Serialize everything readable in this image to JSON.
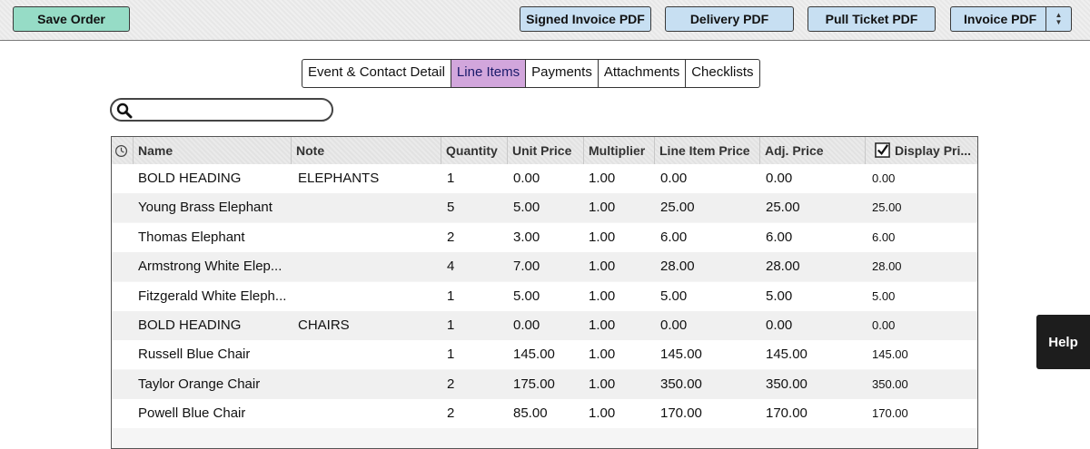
{
  "toolbar": {
    "save_order": "Save Order",
    "signed_invoice_pdf": "Signed Invoice PDF",
    "delivery_pdf": "Delivery PDF",
    "pull_ticket_pdf": "Pull Ticket PDF",
    "invoice_pdf": "Invoice PDF"
  },
  "tabs": [
    {
      "label": "Event & Contact Detail",
      "active": false
    },
    {
      "label": "Line Items",
      "active": true
    },
    {
      "label": "Payments",
      "active": false
    },
    {
      "label": "Attachments",
      "active": false
    },
    {
      "label": "Checklists",
      "active": false
    }
  ],
  "search": {
    "value": "",
    "placeholder": ""
  },
  "columns": {
    "name": "Name",
    "note": "Note",
    "quantity": "Quantity",
    "unit_price": "Unit Price",
    "multiplier": "Multiplier",
    "line_item_price": "Line Item Price",
    "adj_price": "Adj. Price",
    "display_price": "Display Pri..."
  },
  "rows": [
    {
      "name": "BOLD HEADING",
      "note": "ELEPHANTS",
      "quantity": "1",
      "unit_price": "0.00",
      "multiplier": "1.00",
      "line_item_price": "0.00",
      "adj_price": "0.00",
      "display_price": "0.00"
    },
    {
      "name": "Young Brass Elephant",
      "note": "",
      "quantity": "5",
      "unit_price": "5.00",
      "multiplier": "1.00",
      "line_item_price": "25.00",
      "adj_price": "25.00",
      "display_price": "25.00"
    },
    {
      "name": "Thomas Elephant",
      "note": "",
      "quantity": "2",
      "unit_price": "3.00",
      "multiplier": "1.00",
      "line_item_price": "6.00",
      "adj_price": "6.00",
      "display_price": "6.00"
    },
    {
      "name": "Armstrong White Elep...",
      "note": "",
      "quantity": "4",
      "unit_price": "7.00",
      "multiplier": "1.00",
      "line_item_price": "28.00",
      "adj_price": "28.00",
      "display_price": "28.00"
    },
    {
      "name": "Fitzgerald White Eleph...",
      "note": "",
      "quantity": "1",
      "unit_price": "5.00",
      "multiplier": "1.00",
      "line_item_price": "5.00",
      "adj_price": "5.00",
      "display_price": "5.00"
    },
    {
      "name": "BOLD HEADING",
      "note": "CHAIRS",
      "quantity": "1",
      "unit_price": "0.00",
      "multiplier": "1.00",
      "line_item_price": "0.00",
      "adj_price": "0.00",
      "display_price": "0.00"
    },
    {
      "name": "Russell Blue Chair",
      "note": "",
      "quantity": "1",
      "unit_price": "145.00",
      "multiplier": "1.00",
      "line_item_price": "145.00",
      "adj_price": "145.00",
      "display_price": "145.00"
    },
    {
      "name": "Taylor Orange Chair",
      "note": "",
      "quantity": "2",
      "unit_price": "175.00",
      "multiplier": "1.00",
      "line_item_price": "350.00",
      "adj_price": "350.00",
      "display_price": "350.00"
    },
    {
      "name": "Powell Blue Chair",
      "note": "",
      "quantity": "2",
      "unit_price": "85.00",
      "multiplier": "1.00",
      "line_item_price": "170.00",
      "adj_price": "170.00",
      "display_price": "170.00"
    }
  ],
  "help": {
    "label": "Help"
  },
  "icons": {
    "search": "search-icon",
    "clock": "clock-icon",
    "checkbox": "checkbox-checked-icon",
    "sort_arrows": "up-down-arrows-icon"
  },
  "colors": {
    "save_button": "#96dcc6",
    "pdf_button": "#c7dff2",
    "active_tab": "#d2a6dc",
    "help_button": "#1d1d1d"
  }
}
